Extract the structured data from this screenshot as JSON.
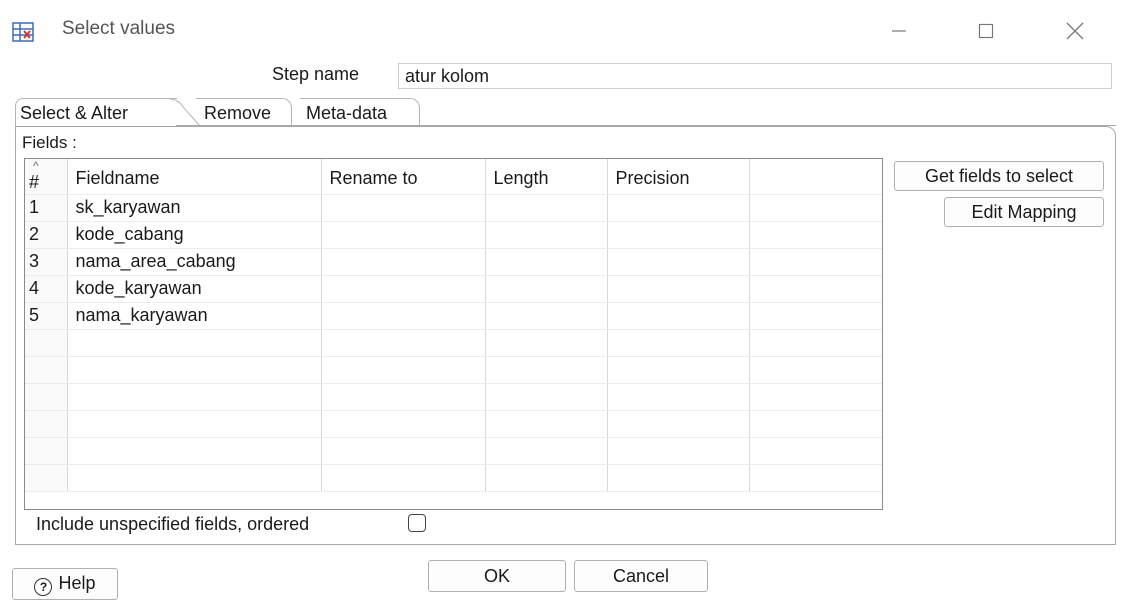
{
  "window": {
    "title": "Select values",
    "controls": {
      "minimize_icon": "minimize-icon",
      "maximize_icon": "maximize-icon",
      "close_icon": "close-icon"
    }
  },
  "step": {
    "label": "Step name",
    "value": "atur kolom"
  },
  "tabs": [
    {
      "label": "Select & Alter",
      "active": true
    },
    {
      "label": "Remove",
      "active": false
    },
    {
      "label": "Meta-data",
      "active": false
    }
  ],
  "fields_label": "Fields :",
  "table": {
    "sort_indicator": "^",
    "columns": [
      "#",
      "Fieldname",
      "Rename to",
      "Length",
      "Precision",
      ""
    ],
    "rows": [
      [
        "1",
        "sk_karyawan",
        "",
        "",
        "",
        ""
      ],
      [
        "2",
        "kode_cabang",
        "",
        "",
        "",
        ""
      ],
      [
        "3",
        "nama_area_cabang",
        "",
        "",
        "",
        ""
      ],
      [
        "4",
        "kode_karyawan",
        "",
        "",
        "",
        ""
      ],
      [
        "5",
        "nama_karyawan",
        "",
        "",
        "",
        ""
      ]
    ],
    "empty_rows": 6
  },
  "buttons": {
    "get_fields": "Get fields to select",
    "edit_mapping": "Edit Mapping",
    "ok": "OK",
    "cancel": "Cancel",
    "help": "Help"
  },
  "include_unspecified": {
    "label": "Include unspecified fields, ordered",
    "checked": false
  },
  "colors": {
    "border": "#a8a8a8",
    "icon_blue": "#3a6fb0",
    "icon_red": "#cc3333"
  }
}
